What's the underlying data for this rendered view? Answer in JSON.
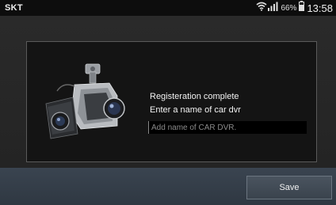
{
  "status_bar": {
    "carrier": "SKT",
    "battery_percent": "66%",
    "time": "13:58",
    "icons": [
      "wifi-icon",
      "signal-icon",
      "battery-icon"
    ]
  },
  "registration": {
    "line1": "Registeration complete",
    "line2": "Enter a name of car dvr",
    "name_input": {
      "value": "",
      "placeholder": "Add name of CAR DVR."
    },
    "image": "car-dvr-camera"
  },
  "footer": {
    "save_label": "Save"
  },
  "colors": {
    "background": "#262626",
    "panel": "#141414",
    "footer": "#343d47",
    "text": "#f2f2f2"
  }
}
